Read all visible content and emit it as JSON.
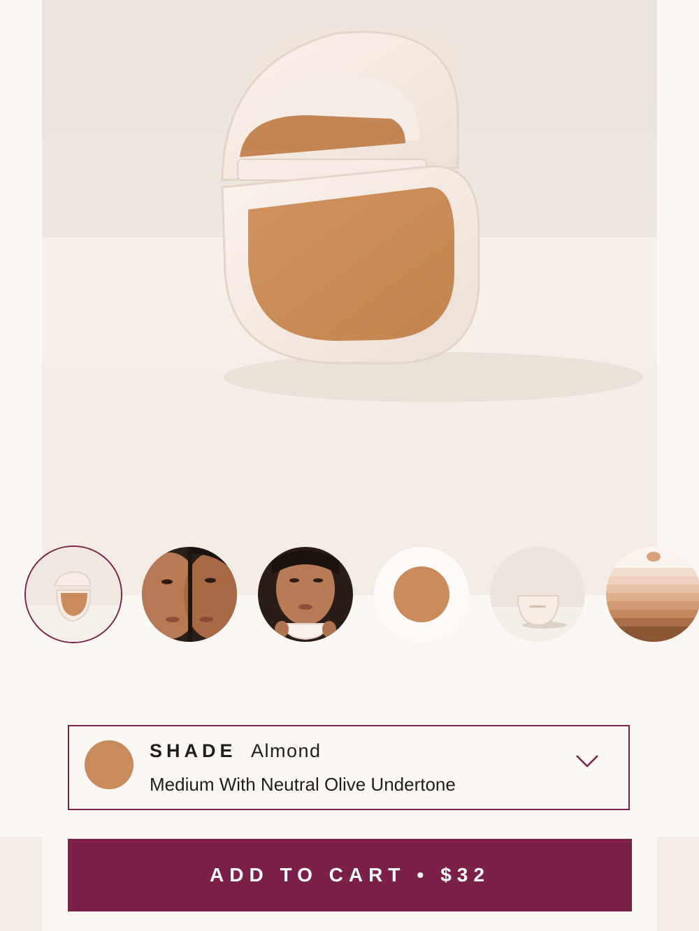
{
  "hero": {
    "image_icon": "compact-powder-icon",
    "colors": {
      "background": "#f4ede6",
      "powder": "#c98b5c",
      "case": "#f2e4da"
    }
  },
  "gallery": {
    "active_index": 0,
    "thumbnails": [
      {
        "icon": "compact-open-icon"
      },
      {
        "icon": "model-face-split-icon"
      },
      {
        "icon": "model-holding-compact-icon"
      },
      {
        "icon": "powder-swatch-icon"
      },
      {
        "icon": "compact-closed-icon"
      },
      {
        "icon": "shade-chart-icon"
      }
    ]
  },
  "shade_selector": {
    "label": "SHADE",
    "name": "Almond",
    "description": "Medium With Neutral Olive Undertone",
    "swatch_color": "#c98b5c",
    "icon": "chevron-down-icon"
  },
  "cart": {
    "label": "ADD TO CART",
    "separator": "•",
    "price": "$32",
    "color": "#7b2048"
  }
}
